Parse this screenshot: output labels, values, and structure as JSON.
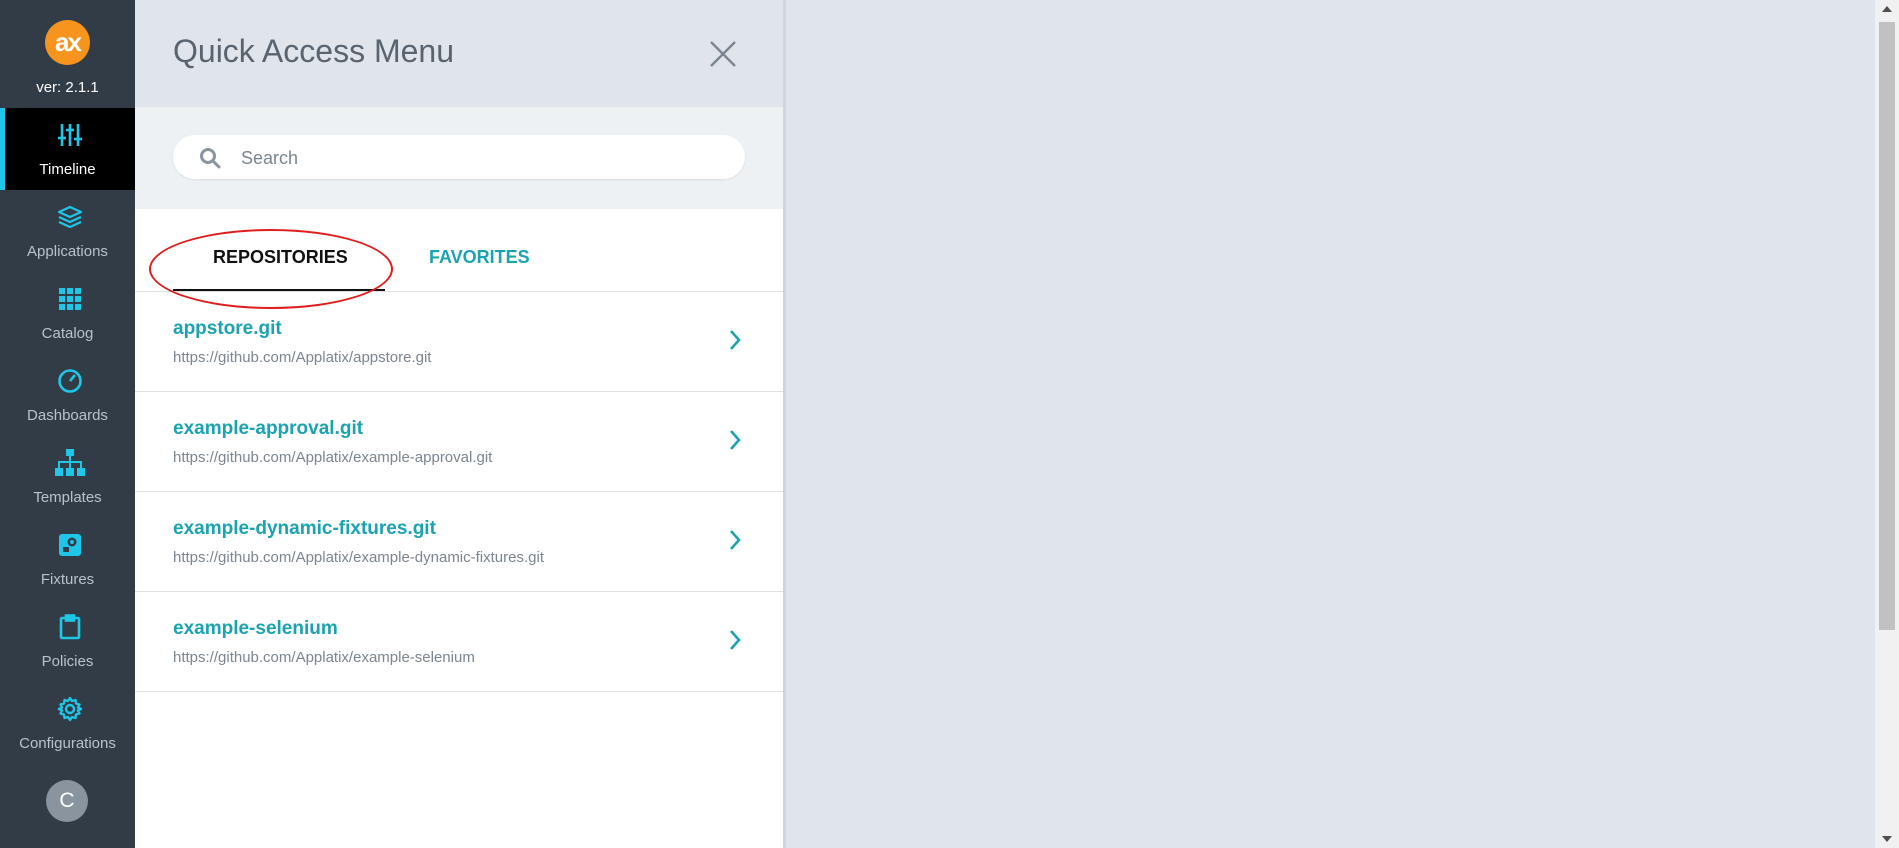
{
  "app": {
    "logo_text": "ax",
    "version": "ver: 2.1.1",
    "brand_color": "#f7941d",
    "accent_color": "#1ec6e8",
    "link_color": "#1aa3b0"
  },
  "nav": {
    "items": [
      {
        "label": "Timeline",
        "icon": "sliders-icon",
        "active": true
      },
      {
        "label": "Applications",
        "icon": "layers-icon",
        "active": false
      },
      {
        "label": "Catalog",
        "icon": "grid-icon",
        "active": false
      },
      {
        "label": "Dashboards",
        "icon": "speedometer-icon",
        "active": false
      },
      {
        "label": "Templates",
        "icon": "sitemap-icon",
        "active": false
      },
      {
        "label": "Fixtures",
        "icon": "fixture-icon",
        "active": false
      },
      {
        "label": "Policies",
        "icon": "clipboard-icon",
        "active": false
      },
      {
        "label": "Configurations",
        "icon": "gear-icon",
        "active": false
      }
    ],
    "avatar_initial": "C"
  },
  "panel": {
    "title": "Quick Access Menu",
    "search_placeholder": "Search",
    "tabs": [
      {
        "label": "REPOSITORIES",
        "active": true
      },
      {
        "label": "FAVORITES",
        "active": false
      }
    ],
    "repositories": [
      {
        "name": "appstore.git",
        "url": "https://github.com/Applatix/appstore.git"
      },
      {
        "name": "example-approval.git",
        "url": "https://github.com/Applatix/example-approval.git"
      },
      {
        "name": "example-dynamic-fixtures.git",
        "url": "https://github.com/Applatix/example-dynamic-fixtures.git"
      },
      {
        "name": "example-selenium",
        "url": "https://github.com/Applatix/example-selenium"
      }
    ]
  }
}
